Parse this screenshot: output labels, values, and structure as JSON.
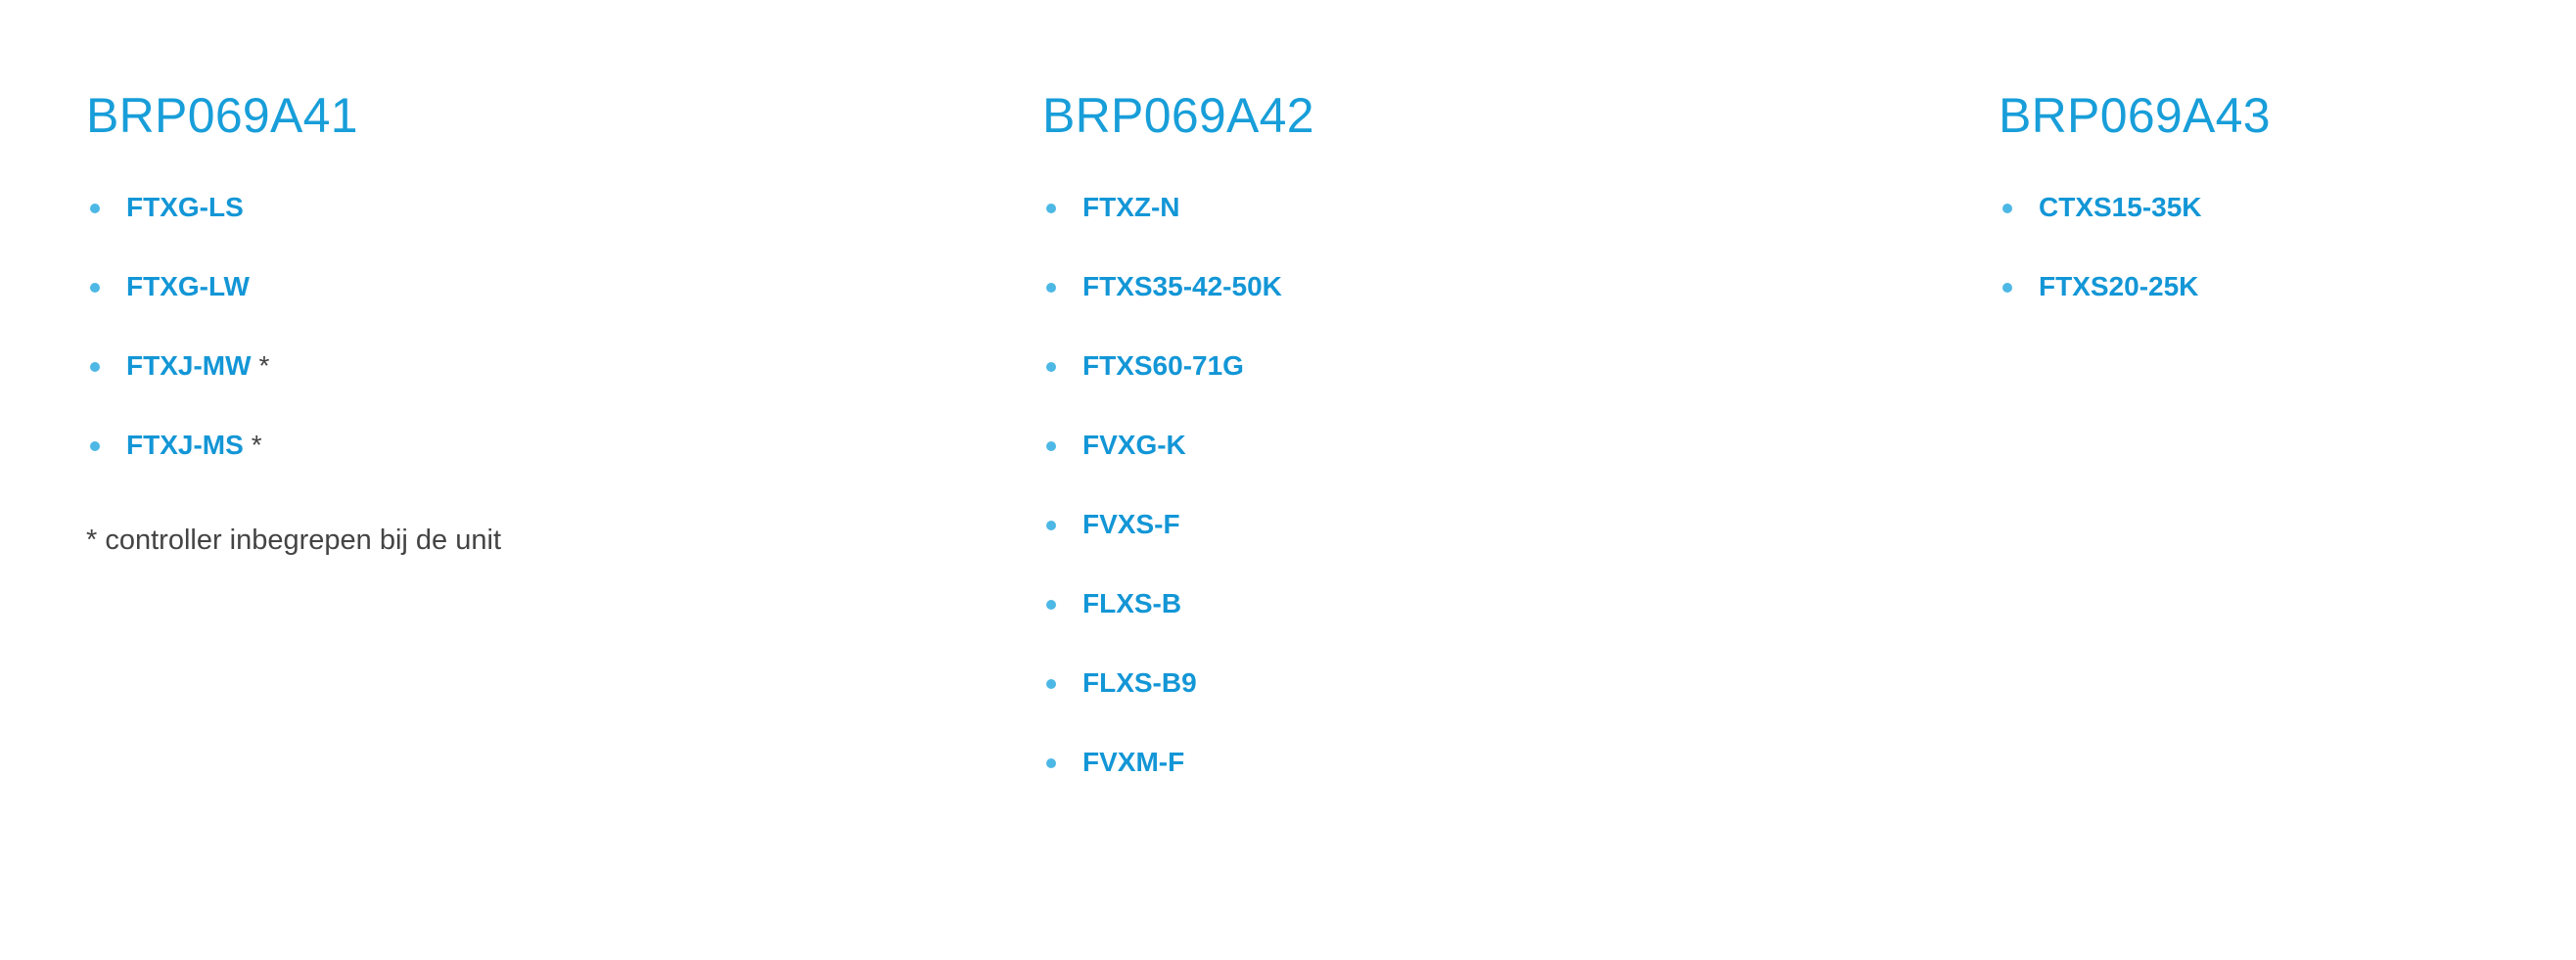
{
  "columns": [
    {
      "title": "BRP069A41",
      "items": [
        {
          "label": "FTXG-LS",
          "mark": ""
        },
        {
          "label": "FTXG-LW",
          "mark": ""
        },
        {
          "label": "FTXJ-MW",
          "mark": "*"
        },
        {
          "label": "FTXJ-MS",
          "mark": "*"
        }
      ],
      "note": "* controller inbegrepen bij de unit"
    },
    {
      "title": "BRP069A42",
      "items": [
        {
          "label": "FTXZ-N"
        },
        {
          "label": "FTXS35-42-50K"
        },
        {
          "label": "FTXS60-71G"
        },
        {
          "label": "FVXG-K"
        },
        {
          "label": "FVXS-F"
        },
        {
          "label": "FLXS-B"
        },
        {
          "label": "FLXS-B9"
        },
        {
          "label": "FVXM-F"
        }
      ]
    },
    {
      "title": "BRP069A43",
      "items": [
        {
          "label": "CTXS15-35K"
        },
        {
          "label": "FTXS20-25K"
        }
      ]
    }
  ],
  "colors": {
    "heading": "#189ed9",
    "link": "#1396d6",
    "bullet": "#4db8e5",
    "text": "#444444"
  }
}
